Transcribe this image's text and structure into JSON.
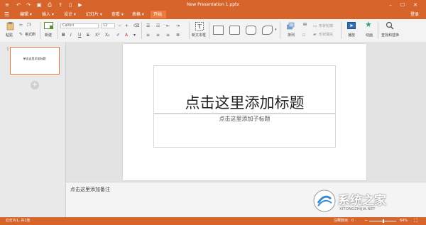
{
  "window": {
    "title": "New Presentation 1.pptx",
    "controls": [
      "–",
      "☐",
      "✕"
    ],
    "quick_access_icons": [
      "menu-icon",
      "undo-icon",
      "redo-icon",
      "save-icon",
      "print-icon",
      "share-icon",
      "new-file-icon",
      "play-icon"
    ]
  },
  "menu": {
    "items": [
      "编辑",
      "插入",
      "设计",
      "幻灯片",
      "查看",
      "表格",
      "开始"
    ],
    "active": "开始",
    "login": "登录"
  },
  "ribbon": {
    "paste": "粘贴",
    "format_painter": "格式刷",
    "new_slide": "新建",
    "font_name": "Calibri",
    "font_size": "12",
    "new_textbox": "新文本框",
    "arrange": "排列",
    "shape_outline": "形状轮廓",
    "shape_fill": "形状填充",
    "play": "播放",
    "animation": "动画",
    "find_replace": "查找和替换"
  },
  "slides_panel": {
    "slide_number": "1",
    "thumb_title": "单击这里添加标题",
    "add_label": "+"
  },
  "slide": {
    "title_placeholder": "点击这里添加标题",
    "subtitle_placeholder": "点击这里添加子标题"
  },
  "notes": {
    "placeholder": "点击这里添加备注"
  },
  "status": {
    "slide_position": "幻灯片1, 共1张",
    "notes_count": "注释数目：0",
    "zoom": "64%"
  },
  "watermark": {
    "brand": "系统之家",
    "url": "XITONGZHIJIA.NET"
  },
  "colors": {
    "accent": "#d7652b",
    "active_tab": "#ec7d41"
  }
}
